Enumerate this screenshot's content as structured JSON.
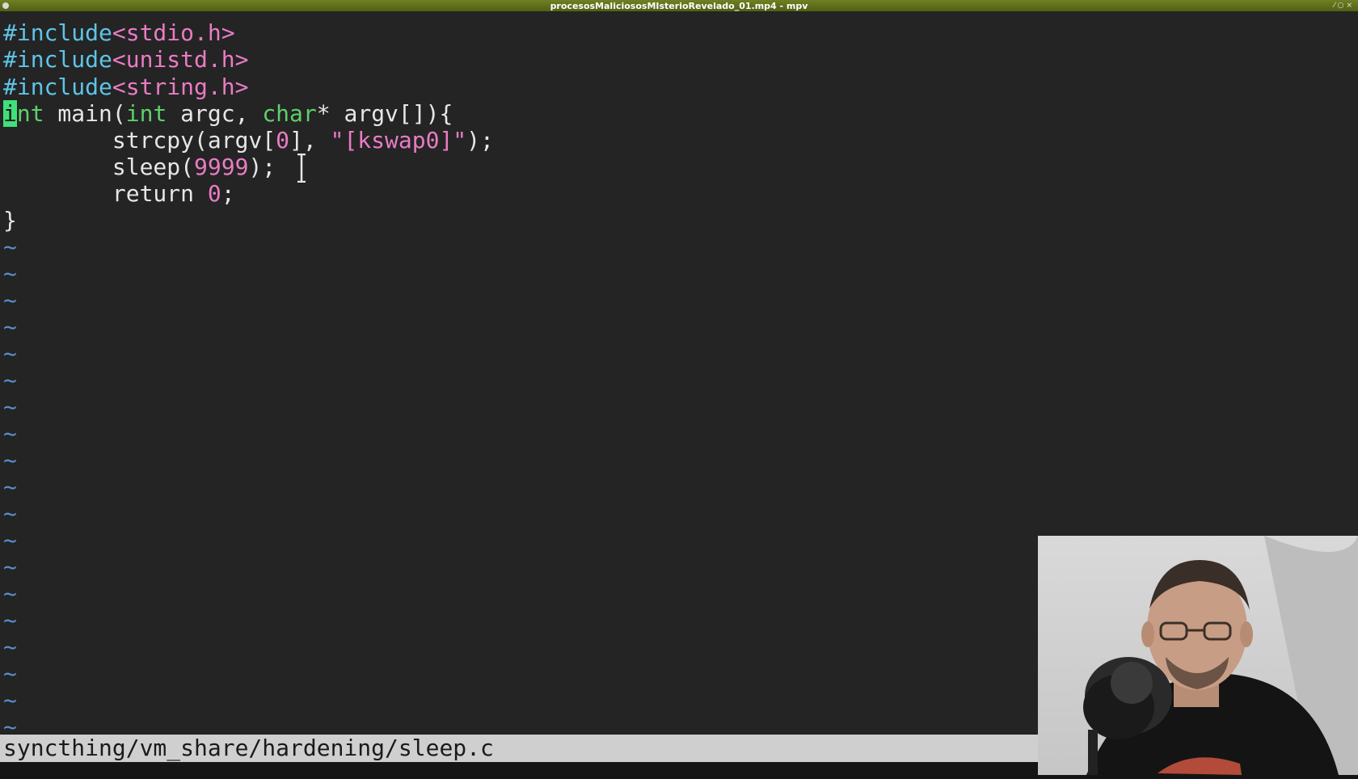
{
  "window": {
    "title": "procesosMaliciososMIsterioRevelado_01.mp4 - mpv"
  },
  "editor": {
    "lines": [
      {
        "p1": "#include",
        "p2": "<stdio.h>"
      },
      {
        "p1": "#include",
        "p2": "<unistd.h>"
      },
      {
        "p1": "#include",
        "p2": "<string.h>"
      },
      {
        "cursor": "i",
        "rest1": "nt",
        "rest2": " main(",
        "t1": "int",
        "rest3": " argc, ",
        "t2": "char",
        "rest4": "* argv[]){"
      },
      {
        "indent": "        ",
        "a": "strcpy(argv[",
        "b": "0",
        "c": "], ",
        "d": "\"[kswap0]\"",
        "e": ");"
      },
      {
        "indent": "        ",
        "a": "sleep(",
        "b": "9999",
        "c": ");"
      },
      {
        "indent": "        ",
        "a": "return ",
        "b": "0",
        "c": ";"
      },
      {
        "a": "}"
      }
    ],
    "tilde": "~"
  },
  "status": {
    "path": "syncthing/vm_share/hardening/sleep.c"
  },
  "colors": {
    "preprocessor": "#5ec4e6",
    "type": "#5fd06a",
    "constant": "#e97cc3",
    "cursor": "#3ee07a"
  }
}
